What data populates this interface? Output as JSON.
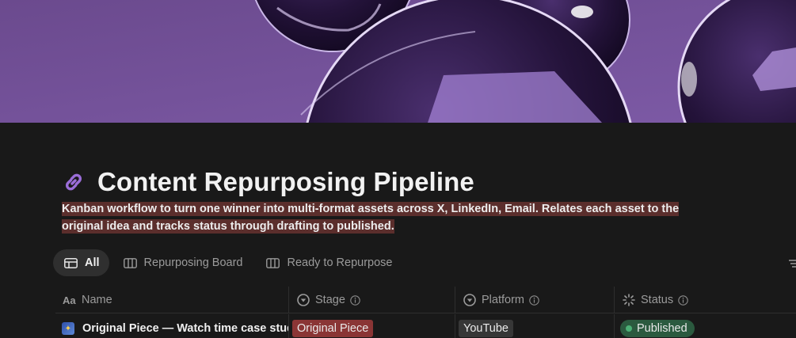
{
  "cover": {
    "image": "purple-glass-spheres",
    "colors": {
      "background": "#7652a0",
      "sphere": "#2a1740"
    }
  },
  "page": {
    "icon": "link-icon",
    "icon_color": "#9a6dd7",
    "title": "Content Repurposing Pipeline",
    "description": "Kanban workflow to turn one winner into multi-format assets across X, LinkedIn, Email. Relates each asset to the original idea and tracks status through drafting to published.",
    "description_highlight": "#5b2e2c"
  },
  "views": {
    "tabs": [
      {
        "label": "All",
        "icon": "table-icon",
        "active": true
      },
      {
        "label": "Repurposing Board",
        "icon": "board-icon",
        "active": false
      },
      {
        "label": "Ready to Repurpose",
        "icon": "board-icon",
        "active": false
      }
    ],
    "more_icon": "settings-lines-icon"
  },
  "table": {
    "columns": [
      {
        "label": "Name",
        "icon": "text-property-icon"
      },
      {
        "label": "Stage",
        "icon": "select-property-icon"
      },
      {
        "label": "Platform",
        "icon": "select-property-icon"
      },
      {
        "label": "Status",
        "icon": "status-property-icon"
      }
    ],
    "rows": [
      {
        "emoji": "sparkle-image-icon",
        "name": "Original Piece — Watch time case study",
        "stage": "Original Piece",
        "platform": "YouTube",
        "status": "Published"
      }
    ]
  },
  "colors": {
    "stage_tag": "#8a3535",
    "platform_tag": "#373737",
    "status_published": "#2b5a3f",
    "status_dot": "#4caf75"
  }
}
